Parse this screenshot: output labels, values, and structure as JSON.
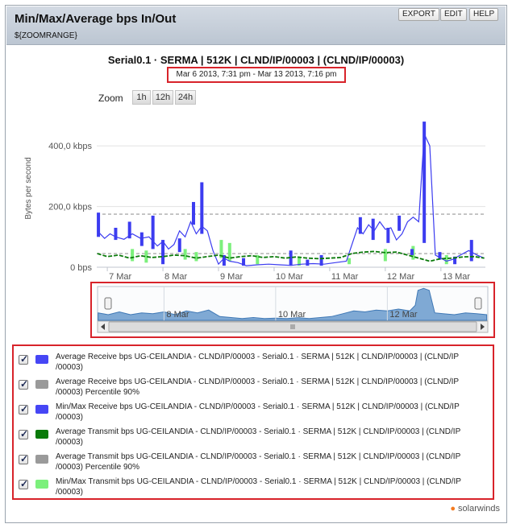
{
  "header": {
    "title": "Min/Max/Average bps In/Out",
    "subtitle": "${ZOOMRANGE}",
    "buttons": [
      "EXPORT",
      "EDIT",
      "HELP"
    ]
  },
  "chart_title": "Serial0.1 · SERMA | 512K | CLND/IP/00003 | (CLND/IP/00003)",
  "date_range": "Mar 6 2013, 7:31 pm - Mar 13 2013, 7:16 pm",
  "zoom": {
    "label": "Zoom",
    "buttons": [
      "1h",
      "12h",
      "24h"
    ]
  },
  "brand": "solarwinds",
  "chart_data": {
    "type": "line",
    "ylabel": "Bytes per second",
    "ylim": [
      0,
      520
    ],
    "y_ticks": [
      {
        "value": 0,
        "label": "0 bps"
      },
      {
        "value": 200,
        "label": "200,0 kbps"
      },
      {
        "value": 400,
        "label": "400,0 kbps"
      }
    ],
    "x_ticks": [
      "7 Mar",
      "8 Mar",
      "9 Mar",
      "10 Mar",
      "11 Mar",
      "12 Mar",
      "13 Mar"
    ],
    "x_range_days": [
      6.81,
      13.8
    ],
    "percentile_lines": [
      {
        "series_ref": "Average Receive bps Percentile 90%",
        "value": 175,
        "color": "#999999"
      },
      {
        "series_ref": "Average Transmit bps Percentile 90%",
        "value": 45,
        "color": "#999999"
      }
    ],
    "series": [
      {
        "name": "Average Receive bps UG-CEILANDIA - CLND/IP/00003 - Serial0.1 · SERMA | 512K | CLND/IP/00003 | (CLND/IP/00003)",
        "color": "#3c3cf0",
        "points": [
          [
            6.82,
            120
          ],
          [
            6.95,
            95
          ],
          [
            7.05,
            110
          ],
          [
            7.15,
            100
          ],
          [
            7.3,
            92
          ],
          [
            7.45,
            110
          ],
          [
            7.6,
            95
          ],
          [
            7.75,
            100
          ],
          [
            7.9,
            70
          ],
          [
            8.0,
            85
          ],
          [
            8.1,
            60
          ],
          [
            8.2,
            75
          ],
          [
            8.3,
            120
          ],
          [
            8.4,
            100
          ],
          [
            8.5,
            150
          ],
          [
            8.6,
            110
          ],
          [
            8.7,
            135
          ],
          [
            8.8,
            120
          ],
          [
            8.9,
            55
          ],
          [
            9.0,
            10
          ],
          [
            9.1,
            30
          ],
          [
            9.2,
            20
          ],
          [
            9.35,
            15
          ],
          [
            9.5,
            5
          ],
          [
            9.7,
            8
          ],
          [
            9.9,
            10
          ],
          [
            10.1,
            8
          ],
          [
            10.3,
            6
          ],
          [
            10.5,
            10
          ],
          [
            10.7,
            12
          ],
          [
            10.9,
            10
          ],
          [
            11.1,
            15
          ],
          [
            11.3,
            20
          ],
          [
            11.5,
            130
          ],
          [
            11.6,
            110
          ],
          [
            11.7,
            140
          ],
          [
            11.8,
            120
          ],
          [
            11.9,
            150
          ],
          [
            12.0,
            125
          ],
          [
            12.1,
            130
          ],
          [
            12.2,
            90
          ],
          [
            12.3,
            110
          ],
          [
            12.4,
            150
          ],
          [
            12.5,
            165
          ],
          [
            12.6,
            150
          ],
          [
            12.7,
            440
          ],
          [
            12.8,
            400
          ],
          [
            12.9,
            40
          ],
          [
            13.0,
            30
          ],
          [
            13.1,
            20
          ],
          [
            13.2,
            25
          ],
          [
            13.35,
            40
          ],
          [
            13.5,
            55
          ],
          [
            13.65,
            40
          ],
          [
            13.78,
            30
          ]
        ]
      },
      {
        "name": "Average Receive bps UG-CEILANDIA - CLND/IP/00003 - Serial0.1 · SERMA | 512K | CLND/IP/00003 | (CLND/IP/00003) Percentile 90%",
        "color": "#999999",
        "values": [
          175
        ]
      },
      {
        "name": "Min/Max Receive bps UG-CEILANDIA - CLND/IP/00003 - Serial0.1 · SERMA | 512K | CLND/IP/00003 | (CLND/IP/00003)",
        "color": "#3c3cf0",
        "ranges": [
          [
            6.84,
            100,
            180
          ],
          [
            7.15,
            90,
            130
          ],
          [
            7.4,
            95,
            150
          ],
          [
            7.62,
            70,
            115
          ],
          [
            7.82,
            60,
            170
          ],
          [
            8.0,
            10,
            90
          ],
          [
            8.3,
            50,
            95
          ],
          [
            8.55,
            140,
            215
          ],
          [
            8.7,
            110,
            280
          ],
          [
            9.1,
            5,
            40
          ],
          [
            9.45,
            5,
            30
          ],
          [
            10.3,
            5,
            55
          ],
          [
            10.6,
            5,
            25
          ],
          [
            10.85,
            5,
            40
          ],
          [
            11.55,
            110,
            165
          ],
          [
            11.78,
            90,
            160
          ],
          [
            12.05,
            80,
            130
          ],
          [
            12.25,
            120,
            170
          ],
          [
            12.48,
            40,
            60
          ],
          [
            12.7,
            80,
            480
          ],
          [
            12.98,
            25,
            50
          ],
          [
            13.25,
            10,
            35
          ],
          [
            13.55,
            20,
            90
          ]
        ]
      },
      {
        "name": "Average Transmit bps UG-CEILANDIA - CLND/IP/00003 - Serial0.1 · SERMA | 512K | CLND/IP/00003 | (CLND/IP/00003)",
        "color": "#0a7a0a",
        "points": [
          [
            6.82,
            45
          ],
          [
            7.0,
            35
          ],
          [
            7.2,
            40
          ],
          [
            7.4,
            30
          ],
          [
            7.6,
            38
          ],
          [
            7.8,
            32
          ],
          [
            8.0,
            35
          ],
          [
            8.2,
            40
          ],
          [
            8.4,
            38
          ],
          [
            8.6,
            30
          ],
          [
            8.8,
            35
          ],
          [
            9.0,
            40
          ],
          [
            9.2,
            30
          ],
          [
            9.4,
            35
          ],
          [
            9.6,
            38
          ],
          [
            9.8,
            32
          ],
          [
            10.0,
            35
          ],
          [
            10.2,
            30
          ],
          [
            10.4,
            34
          ],
          [
            10.6,
            30
          ],
          [
            10.8,
            28
          ],
          [
            11.0,
            30
          ],
          [
            11.2,
            32
          ],
          [
            11.4,
            45
          ],
          [
            11.6,
            50
          ],
          [
            11.8,
            52
          ],
          [
            12.0,
            48
          ],
          [
            12.2,
            50
          ],
          [
            12.4,
            40
          ],
          [
            12.6,
            30
          ],
          [
            12.8,
            20
          ],
          [
            13.0,
            28
          ],
          [
            13.2,
            30
          ],
          [
            13.4,
            34
          ],
          [
            13.6,
            35
          ],
          [
            13.78,
            30
          ]
        ]
      },
      {
        "name": "Average Transmit bps UG-CEILANDIA - CLND/IP/00003 - Serial0.1 · SERMA | 512K | CLND/IP/00003 | (CLND/IP/00003) Percentile 90%",
        "color": "#999999",
        "values": [
          45
        ]
      },
      {
        "name": "Min/Max Transmit bps UG-CEILANDIA - CLND/IP/00003 - Serial0.1 · SERMA | 512K | CLND/IP/00003 | (CLND/IP/00003)",
        "color": "#7cf07c",
        "ranges": [
          [
            7.45,
            20,
            60
          ],
          [
            7.7,
            15,
            55
          ],
          [
            8.4,
            25,
            60
          ],
          [
            8.6,
            20,
            50
          ],
          [
            9.05,
            30,
            90
          ],
          [
            9.2,
            20,
            80
          ],
          [
            9.7,
            10,
            40
          ],
          [
            10.45,
            5,
            35
          ],
          [
            11.35,
            10,
            30
          ],
          [
            12.0,
            20,
            60
          ],
          [
            12.5,
            25,
            70
          ],
          [
            13.1,
            10,
            40
          ]
        ]
      }
    ],
    "navigator": {
      "x_ticks": [
        "8 Mar",
        "10 Mar",
        "12 Mar"
      ],
      "values": [
        [
          6.82,
          40
        ],
        [
          7.0,
          30
        ],
        [
          7.2,
          45
        ],
        [
          7.4,
          30
        ],
        [
          7.6,
          40
        ],
        [
          7.8,
          35
        ],
        [
          8.0,
          45
        ],
        [
          8.2,
          30
        ],
        [
          8.4,
          50
        ],
        [
          8.6,
          40
        ],
        [
          8.8,
          55
        ],
        [
          9.0,
          20
        ],
        [
          9.2,
          15
        ],
        [
          9.4,
          10
        ],
        [
          9.6,
          15
        ],
        [
          9.8,
          10
        ],
        [
          10.0,
          12
        ],
        [
          10.2,
          10
        ],
        [
          10.4,
          14
        ],
        [
          10.6,
          10
        ],
        [
          10.8,
          15
        ],
        [
          11.0,
          20
        ],
        [
          11.2,
          35
        ],
        [
          11.4,
          50
        ],
        [
          11.6,
          45
        ],
        [
          11.8,
          55
        ],
        [
          12.0,
          50
        ],
        [
          12.2,
          60
        ],
        [
          12.4,
          50
        ],
        [
          12.5,
          80
        ],
        [
          12.55,
          160
        ],
        [
          12.65,
          170
        ],
        [
          12.75,
          160
        ],
        [
          12.85,
          40
        ],
        [
          13.0,
          35
        ],
        [
          13.2,
          30
        ],
        [
          13.4,
          40
        ],
        [
          13.6,
          35
        ],
        [
          13.78,
          30
        ]
      ],
      "ylim": [
        0,
        180
      ]
    }
  },
  "legend": [
    {
      "label": "Average Receive bps UG-CEILANDIA - CLND/IP/00003 - Serial0.1 · SERMA | 512K | CLND/IP/00003 | (CLND/IP /00003)",
      "color": "#4646f5",
      "checked": true
    },
    {
      "label": "Average Receive bps UG-CEILANDIA - CLND/IP/00003 - Serial0.1 · SERMA | 512K | CLND/IP/00003 | (CLND/IP /00003) Percentile 90%",
      "color": "#9a9a9a",
      "checked": true
    },
    {
      "label": "Min/Max Receive bps UG-CEILANDIA - CLND/IP/00003 - Serial0.1 · SERMA | 512K | CLND/IP/00003 | (CLND/IP /00003)",
      "color": "#4646f5",
      "checked": true
    },
    {
      "label": "Average Transmit bps UG-CEILANDIA - CLND/IP/00003 - Serial0.1 · SERMA | 512K | CLND/IP/00003 | (CLND/IP /00003)",
      "color": "#0a7a0a",
      "checked": true
    },
    {
      "label": "Average Transmit bps UG-CEILANDIA - CLND/IP/00003 - Serial0.1 · SERMA | 512K | CLND/IP/00003 | (CLND/IP /00003) Percentile 90%",
      "color": "#9a9a9a",
      "checked": true
    },
    {
      "label": "Min/Max Transmit bps UG-CEILANDIA - CLND/IP/00003 - Serial0.1 · SERMA | 512K | CLND/IP/00003 | (CLND/IP /00003)",
      "color": "#7cf07c",
      "checked": true
    }
  ]
}
